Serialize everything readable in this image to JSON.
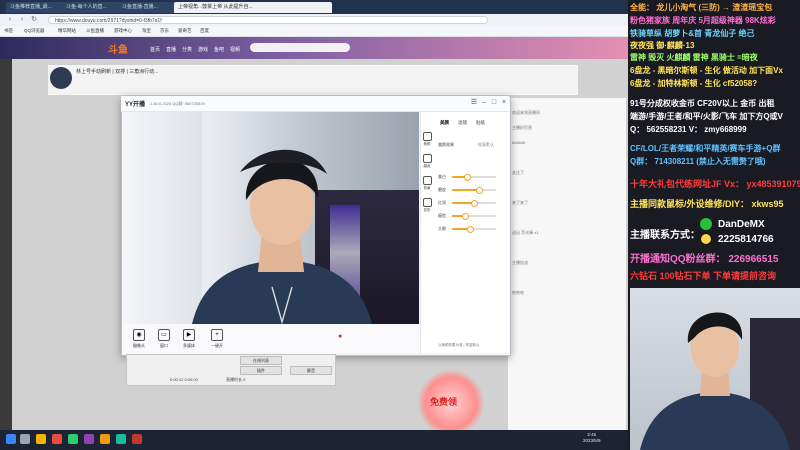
{
  "browser": {
    "tabs": [
      "斗鱼推荐直播_最...",
      "斗鱼-每个人的直...",
      "斗鱼直播-直播...",
      "上帝视角...鼓掌上帝 从此提升自..."
    ],
    "url": "https://www.douyu.com/2971?dyshid=0-f3fb7a1f"
  },
  "bookmarks": [
    "书签",
    "QQ浏览器",
    "精华网站",
    "斗鱼直播",
    "游戏中心",
    "淘宝",
    "京东",
    "爱奇艺",
    "百度"
  ],
  "site": {
    "logo": "斗鱼",
    "nav": [
      "首页",
      "直播",
      "分类",
      "游戏",
      "鱼吧",
      "视频"
    ]
  },
  "room": {
    "title": "林上号手动刷新 | 双排 | 三角洲行动...",
    "chat_lines": [
      "欢迎来到直播间",
      "主播好厉害",
      "666666",
      "关注了",
      "来了来了",
      "送出 荧光棒 x1",
      "主播加油",
      "哈哈哈"
    ],
    "gift_promo": "免费领"
  },
  "yy": {
    "app_name": "YY开播",
    "version": "1.30.0.2025  QQ群: 960720519",
    "side_tabs": [
      "美颜",
      "滤镜",
      "贴纸"
    ],
    "side_icons": [
      "美颜",
      "磨皮",
      "背景",
      "变形"
    ],
    "sliders": [
      {
        "label": "美白",
        "value": 0.35
      },
      {
        "label": "磨皮",
        "value": 0.62
      },
      {
        "label": "红润",
        "value": 0.5
      },
      {
        "label": "瘦脸",
        "value": 0.3
      },
      {
        "label": "大眼",
        "value": 0.4
      }
    ],
    "toggle_label": "美颜效果",
    "reset_label": "恢复默认",
    "footer": "以美颜效果为准  |  恢复默认",
    "tools": [
      "摄像头",
      "窗口",
      "多媒体",
      "一键开"
    ],
    "under": {
      "buttons": [
        "在线列表",
        "插件",
        "静音"
      ],
      "stats": [
        "0:00:12  0:00:00",
        "直播时长 0"
      ]
    }
  },
  "taskbar": {
    "time": "2:45",
    "date": "2023/5/9"
  },
  "overlay_text": [
    {
      "text": "全能：  龙儿小淘气  (三防)  →  渣渣瑶宝包",
      "color": "#ffb347"
    },
    {
      "text": "粉色猪家族  周年庆  5月超级神器  98K炫彩",
      "color": "#ff6fd2"
    },
    {
      "text": "铁骑草纵  胡萝卜&首  青龙仙子  绝己",
      "color": "#6ad4ff"
    },
    {
      "text": "夜夜强  御·麒麟·13",
      "color": "#ffe45c"
    },
    {
      "text": "雷神  毁灭  火麒麟  雷神  黑骑士  =暗夜",
      "color": "#9dff6a"
    },
    {
      "text": "6盘龙 - 黑暗尔斯顿 - 生化    做活动  加下面Vx",
      "color": "#ffe45c"
    },
    {
      "text": "6盘龙 - 加特林斯顿 - 生化       cf52058?",
      "color": "#ffe45c"
    },
    {
      "text": "91号分成权收金币  CF20V以上    金币  出租",
      "color": "#ffffff"
    },
    {
      "text": "端游/手游/王者/和平/火影/飞车  加下方Q或V",
      "color": "#ffffff"
    },
    {
      "text": "Q：  562558231  V：  zmy668999",
      "color": "#ffffff"
    },
    {
      "text": "CF/LOL/王者荣耀/和平精英/赛车手游+Q群",
      "color": "#5ec2ff"
    },
    {
      "text": "Q群：  714308211  (禁止入无需赘了哦)",
      "color": "#5ec2ff"
    },
    {
      "text": "十年大礼包代练网址JF Vx：  yx485391079",
      "color": "#ff3b3b"
    },
    {
      "text": "主播同款鼠标/外设维修/DIY：  xkws95",
      "color": "#ffe45c"
    },
    {
      "text": "主播联系方式：",
      "color": "#ffffff"
    },
    {
      "text": "DanDeMX",
      "color": "#ffffff"
    },
    {
      "text": "2225814766",
      "color": "#ffffff"
    },
    {
      "text": "开播通知QQ粉丝群：  226966515",
      "color": "#ff6fd2"
    },
    {
      "text": "六钻石  100钻石下单    下单请提前咨询",
      "color": "#ff3b3b"
    }
  ],
  "colors": {
    "accent": "#f3a623",
    "site_logo": "#ff7a1a"
  }
}
